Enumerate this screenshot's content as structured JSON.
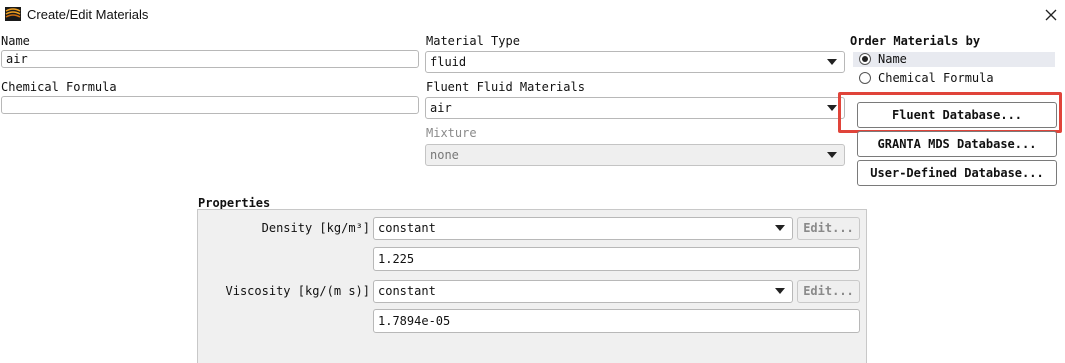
{
  "window": {
    "title": "Create/Edit Materials",
    "icon": "fluent-logo-icon",
    "close_icon": "close-icon"
  },
  "fields": {
    "name_label": "Name",
    "name_value": "air",
    "chemical_formula_label": "Chemical Formula",
    "chemical_formula_value": "",
    "material_type_label": "Material Type",
    "material_type_value": "fluid",
    "fluent_fluid_materials_label": "Fluent Fluid Materials",
    "fluent_fluid_materials_value": "air",
    "mixture_label": "Mixture",
    "mixture_value": "none"
  },
  "order_by": {
    "label": "Order Materials by",
    "options": [
      {
        "label": "Name",
        "selected": true
      },
      {
        "label": "Chemical Formula",
        "selected": false
      }
    ]
  },
  "database_buttons": {
    "fluent": "Fluent Database...",
    "granta": "GRANTA MDS Database...",
    "user_defined": "User-Defined Database..."
  },
  "properties": {
    "label": "Properties",
    "density": {
      "label": "Density [kg/m³]",
      "method": "constant",
      "edit_label": "Edit...",
      "value": "1.225"
    },
    "viscosity": {
      "label": "Viscosity [kg/(m s)]",
      "method": "constant",
      "edit_label": "Edit...",
      "value": "1.7894e-05"
    }
  },
  "colors": {
    "highlight": "#e0443a",
    "panel_bg": "#f0f0f0",
    "selected_row_bg": "#e8eaf0"
  }
}
